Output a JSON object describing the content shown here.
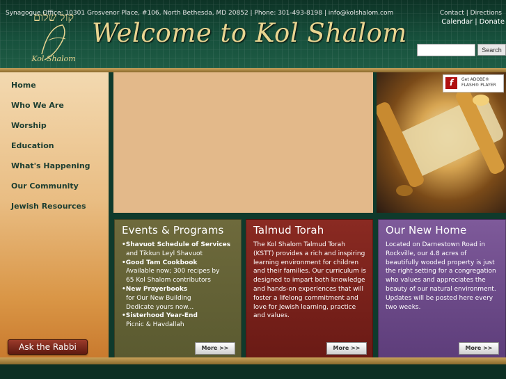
{
  "header": {
    "logo_hebrew": "קול שלום",
    "logo_name": "Kol Shalom",
    "title": "Welcome to Kol Shalom",
    "top_links": [
      "Calendar",
      "Donate"
    ],
    "search": {
      "value": "",
      "placeholder": "",
      "button_label": "Search"
    }
  },
  "nav": {
    "items": [
      "Home",
      "Who We Are",
      "Worship",
      "Education",
      "What's Happening",
      "Our Community",
      "Jewish Resources"
    ],
    "ask_rabbi_label": "Ask the Rabbi"
  },
  "flash_badge": {
    "line1": "Get ADOBE®",
    "line2": "FLASH® PLAYER",
    "icon": "f"
  },
  "panels": {
    "events": {
      "title": "Events & Programs",
      "entries": [
        {
          "head": "•Shavuot Schedule of Services",
          "sub": [
            "and Tikkun Leyl Shavuot"
          ]
        },
        {
          "head": "•Good Tam Cookbook",
          "sub": [
            "Available now; 300 recipes by",
            "65 Kol Shalom contributors"
          ]
        },
        {
          "head": "•New Prayerbooks",
          "sub": [
            "for Our New Building",
            "Dedicate yours now..."
          ]
        },
        {
          "head": "•Sisterhood Year-End",
          "sub": [
            "Picnic & Havdallah"
          ]
        }
      ],
      "more_label": "More >>"
    },
    "talmud": {
      "title": "Talmud Torah",
      "text": "The Kol Shalom Talmud Torah (KSTT) provides a rich and inspiring learning environment for children and their families. Our curriculum is designed to impart both knowledge and hands-on experiences that will foster a lifelong commitment and love for Jewish learning, practice and values.",
      "more_label": "More >>"
    },
    "home": {
      "title": "Our New Home",
      "text": "Located on Darnestown Road in Rockville, our 4.8 acres of beautifully wooded property is just the right setting for a congregation who values and appreciates the beauty of our natural environment. Updates will be posted here every two weeks.",
      "more_label": "More >>"
    }
  },
  "footer": {
    "address": "Synagogue Office: 10301 Grosvenor Place, #106, North Bethesda, MD 20852 | Phone: 301-493-8198 | info@kolshalom.com",
    "links": [
      "Contact",
      "Directions"
    ]
  },
  "colors": {
    "header_green": "#17503c",
    "gold": "#c9a25a",
    "nav_text": "#1d3e31",
    "events_panel": "#5f5d33",
    "talmud_panel": "#7a231c",
    "home_panel": "#6a4a88"
  }
}
